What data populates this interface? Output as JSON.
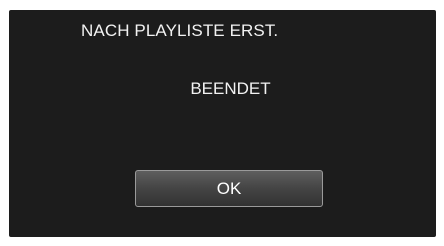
{
  "dialog": {
    "title": "NACH PLAYLISTE ERST.",
    "message": "BEENDET",
    "ok_label": "OK"
  }
}
